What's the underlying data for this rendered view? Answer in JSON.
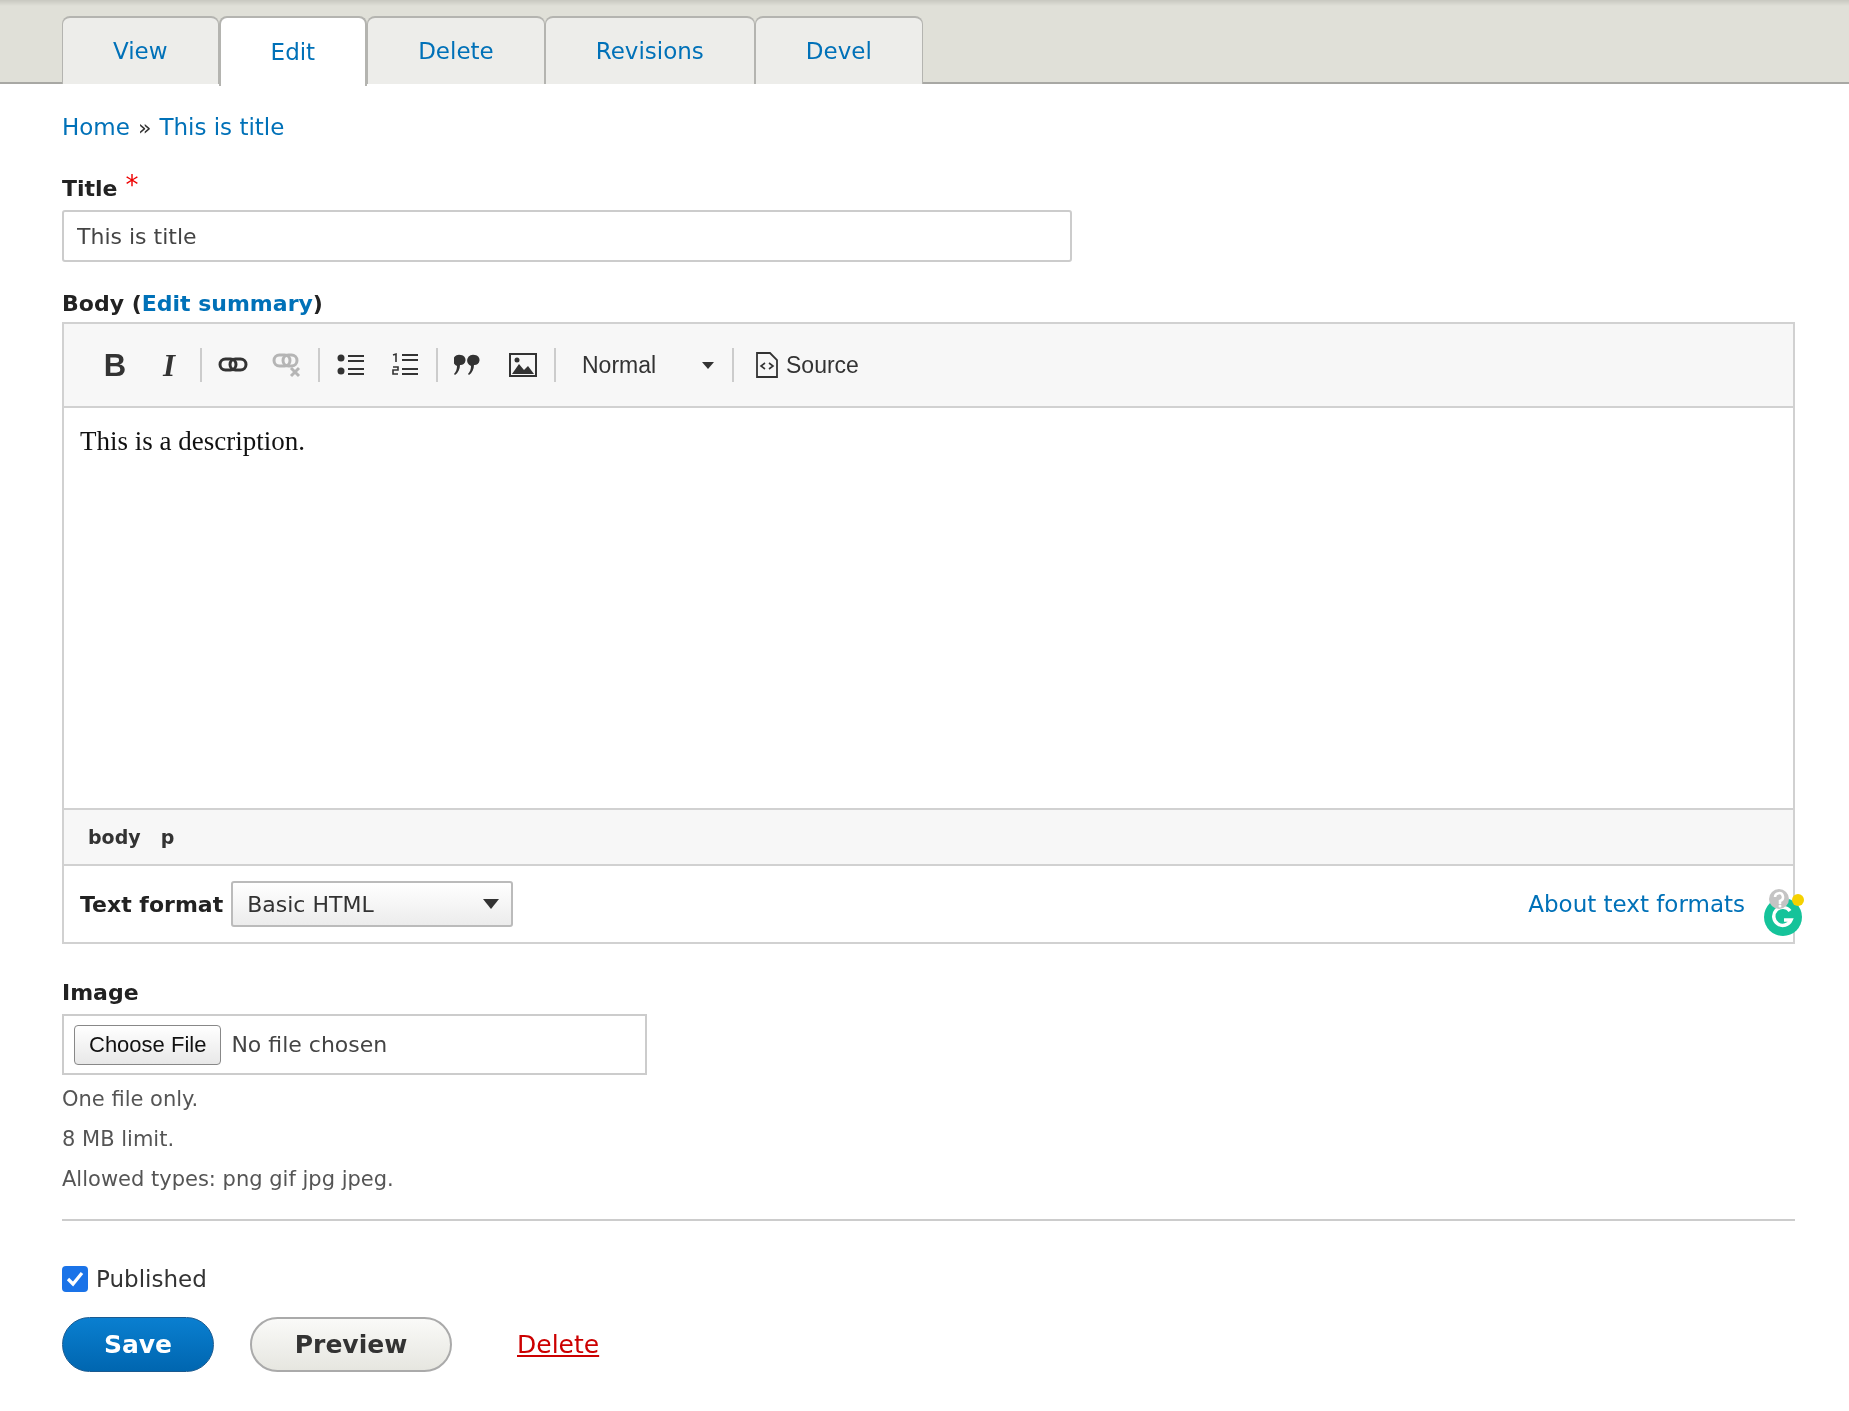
{
  "tabs": [
    {
      "label": "View",
      "selected": false
    },
    {
      "label": "Edit",
      "selected": true
    },
    {
      "label": "Delete",
      "selected": false
    },
    {
      "label": "Revisions",
      "selected": false
    },
    {
      "label": "Devel",
      "selected": false
    }
  ],
  "breadcrumb": {
    "items": [
      "Home",
      "This is title"
    ],
    "separator": "»"
  },
  "title_field": {
    "label": "Title",
    "required": true,
    "required_mark": "*",
    "value": "This is title"
  },
  "body": {
    "label": "Body (",
    "summary_link": "Edit summary",
    "label_end": ")",
    "toolbar": {
      "groups": [
        [
          {
            "kind": "bold",
            "label": "B",
            "disabled": false
          },
          {
            "kind": "italic",
            "label": "I",
            "disabled": false
          }
        ],
        [
          {
            "kind": "link",
            "disabled": false
          },
          {
            "kind": "unlink",
            "disabled": true
          }
        ],
        [
          {
            "kind": "bulleted-list",
            "disabled": false
          },
          {
            "kind": "numbered-list",
            "disabled": false
          }
        ],
        [
          {
            "kind": "blockquote",
            "disabled": false
          },
          {
            "kind": "image",
            "disabled": false
          }
        ]
      ],
      "format": "Normal",
      "source": "Source"
    },
    "content": "This is a description.",
    "path": [
      "body",
      "p"
    ],
    "text_format": {
      "label": "Text format",
      "value": "Basic HTML",
      "help_link": "About text formats"
    }
  },
  "image": {
    "label": "Image",
    "button": "Choose File",
    "status": "No file chosen",
    "help": [
      "One file only.",
      "8 MB limit.",
      "Allowed types: png gif jpg jpeg."
    ]
  },
  "published": {
    "label": "Published",
    "checked": true
  },
  "actions": {
    "save": "Save",
    "preview": "Preview",
    "delete": "Delete"
  }
}
